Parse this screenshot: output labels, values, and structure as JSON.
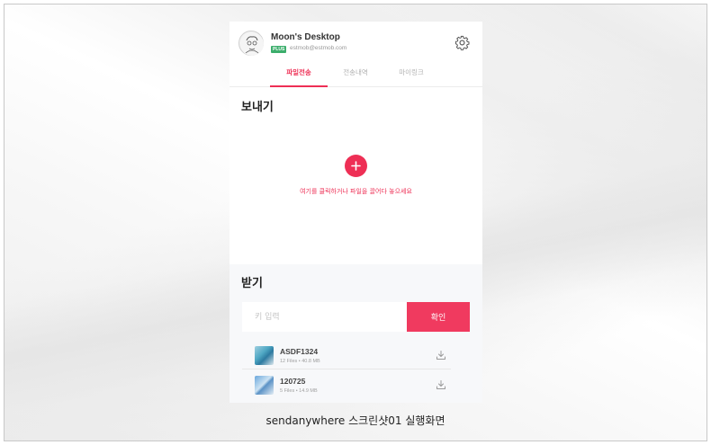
{
  "header": {
    "device_name": "Moon's Desktop",
    "plan_badge": "PLUS",
    "email": "estmob@estmob.com",
    "settings_icon": "gear-icon"
  },
  "tabs": [
    {
      "label": "파일전송",
      "active": true
    },
    {
      "label": "전송내역",
      "active": false
    },
    {
      "label": "마이링크",
      "active": false
    }
  ],
  "send": {
    "title": "보내기",
    "add_icon": "plus-icon",
    "drop_hint": "여기를 클릭하거나 파일을 끌어다 놓으세요"
  },
  "receive": {
    "title": "받기",
    "key_placeholder": "키 입력",
    "confirm_label": "확인",
    "files": [
      {
        "name": "ASDF1324",
        "meta": "12 Files • 40.8 MB",
        "icon": "download-icon"
      },
      {
        "name": "120725",
        "meta": "5 Files • 14.9 MB",
        "icon": "download-icon"
      }
    ]
  },
  "colors": {
    "accent": "#ee2f55",
    "plan_badge": "#3cae6c"
  },
  "caption": "sendanywhere 스크린샷01 실행화면"
}
